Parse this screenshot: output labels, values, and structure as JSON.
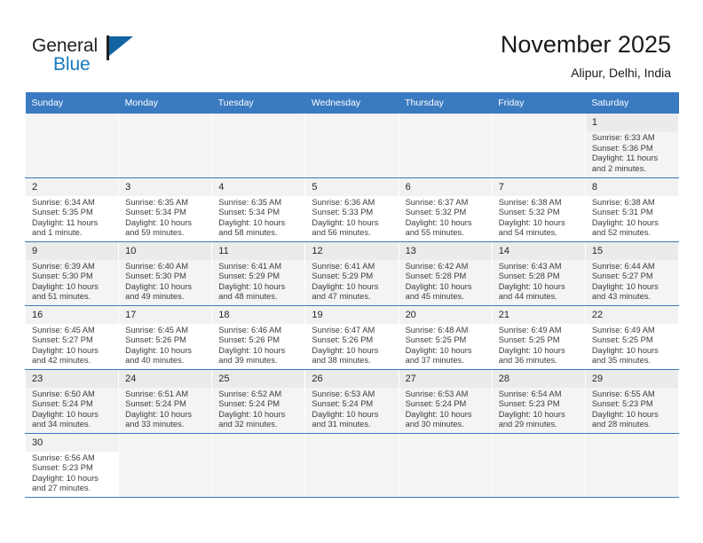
{
  "brand": {
    "name_top": "General",
    "name_bottom": "Blue",
    "flag_color": "#1264a3",
    "text_color": "#231f20",
    "blue_color": "#1878be"
  },
  "header": {
    "title": "November 2025",
    "subtitle": "Alipur, Delhi, India",
    "accent_color": "#3a7ac0"
  },
  "weekdays": [
    "Sunday",
    "Monday",
    "Tuesday",
    "Wednesday",
    "Thursday",
    "Friday",
    "Saturday"
  ],
  "labels": {
    "sunrise": "Sunrise:",
    "sunset": "Sunset:",
    "daylight": "Daylight:"
  },
  "weeks": [
    [
      {
        "day": "",
        "empty": true
      },
      {
        "day": "",
        "empty": true
      },
      {
        "day": "",
        "empty": true
      },
      {
        "day": "",
        "empty": true
      },
      {
        "day": "",
        "empty": true
      },
      {
        "day": "",
        "empty": true
      },
      {
        "day": "1",
        "sunrise": "Sunrise: 6:33 AM",
        "sunset": "Sunset: 5:36 PM",
        "daylight": "Daylight: 11 hours and 2 minutes."
      }
    ],
    [
      {
        "day": "2",
        "sunrise": "Sunrise: 6:34 AM",
        "sunset": "Sunset: 5:35 PM",
        "daylight": "Daylight: 11 hours and 1 minute."
      },
      {
        "day": "3",
        "sunrise": "Sunrise: 6:35 AM",
        "sunset": "Sunset: 5:34 PM",
        "daylight": "Daylight: 10 hours and 59 minutes."
      },
      {
        "day": "4",
        "sunrise": "Sunrise: 6:35 AM",
        "sunset": "Sunset: 5:34 PM",
        "daylight": "Daylight: 10 hours and 58 minutes."
      },
      {
        "day": "5",
        "sunrise": "Sunrise: 6:36 AM",
        "sunset": "Sunset: 5:33 PM",
        "daylight": "Daylight: 10 hours and 56 minutes."
      },
      {
        "day": "6",
        "sunrise": "Sunrise: 6:37 AM",
        "sunset": "Sunset: 5:32 PM",
        "daylight": "Daylight: 10 hours and 55 minutes."
      },
      {
        "day": "7",
        "sunrise": "Sunrise: 6:38 AM",
        "sunset": "Sunset: 5:32 PM",
        "daylight": "Daylight: 10 hours and 54 minutes."
      },
      {
        "day": "8",
        "sunrise": "Sunrise: 6:38 AM",
        "sunset": "Sunset: 5:31 PM",
        "daylight": "Daylight: 10 hours and 52 minutes."
      }
    ],
    [
      {
        "day": "9",
        "sunrise": "Sunrise: 6:39 AM",
        "sunset": "Sunset: 5:30 PM",
        "daylight": "Daylight: 10 hours and 51 minutes."
      },
      {
        "day": "10",
        "sunrise": "Sunrise: 6:40 AM",
        "sunset": "Sunset: 5:30 PM",
        "daylight": "Daylight: 10 hours and 49 minutes."
      },
      {
        "day": "11",
        "sunrise": "Sunrise: 6:41 AM",
        "sunset": "Sunset: 5:29 PM",
        "daylight": "Daylight: 10 hours and 48 minutes."
      },
      {
        "day": "12",
        "sunrise": "Sunrise: 6:41 AM",
        "sunset": "Sunset: 5:29 PM",
        "daylight": "Daylight: 10 hours and 47 minutes."
      },
      {
        "day": "13",
        "sunrise": "Sunrise: 6:42 AM",
        "sunset": "Sunset: 5:28 PM",
        "daylight": "Daylight: 10 hours and 45 minutes."
      },
      {
        "day": "14",
        "sunrise": "Sunrise: 6:43 AM",
        "sunset": "Sunset: 5:28 PM",
        "daylight": "Daylight: 10 hours and 44 minutes."
      },
      {
        "day": "15",
        "sunrise": "Sunrise: 6:44 AM",
        "sunset": "Sunset: 5:27 PM",
        "daylight": "Daylight: 10 hours and 43 minutes."
      }
    ],
    [
      {
        "day": "16",
        "sunrise": "Sunrise: 6:45 AM",
        "sunset": "Sunset: 5:27 PM",
        "daylight": "Daylight: 10 hours and 42 minutes."
      },
      {
        "day": "17",
        "sunrise": "Sunrise: 6:45 AM",
        "sunset": "Sunset: 5:26 PM",
        "daylight": "Daylight: 10 hours and 40 minutes."
      },
      {
        "day": "18",
        "sunrise": "Sunrise: 6:46 AM",
        "sunset": "Sunset: 5:26 PM",
        "daylight": "Daylight: 10 hours and 39 minutes."
      },
      {
        "day": "19",
        "sunrise": "Sunrise: 6:47 AM",
        "sunset": "Sunset: 5:26 PM",
        "daylight": "Daylight: 10 hours and 38 minutes."
      },
      {
        "day": "20",
        "sunrise": "Sunrise: 6:48 AM",
        "sunset": "Sunset: 5:25 PM",
        "daylight": "Daylight: 10 hours and 37 minutes."
      },
      {
        "day": "21",
        "sunrise": "Sunrise: 6:49 AM",
        "sunset": "Sunset: 5:25 PM",
        "daylight": "Daylight: 10 hours and 36 minutes."
      },
      {
        "day": "22",
        "sunrise": "Sunrise: 6:49 AM",
        "sunset": "Sunset: 5:25 PM",
        "daylight": "Daylight: 10 hours and 35 minutes."
      }
    ],
    [
      {
        "day": "23",
        "sunrise": "Sunrise: 6:50 AM",
        "sunset": "Sunset: 5:24 PM",
        "daylight": "Daylight: 10 hours and 34 minutes."
      },
      {
        "day": "24",
        "sunrise": "Sunrise: 6:51 AM",
        "sunset": "Sunset: 5:24 PM",
        "daylight": "Daylight: 10 hours and 33 minutes."
      },
      {
        "day": "25",
        "sunrise": "Sunrise: 6:52 AM",
        "sunset": "Sunset: 5:24 PM",
        "daylight": "Daylight: 10 hours and 32 minutes."
      },
      {
        "day": "26",
        "sunrise": "Sunrise: 6:53 AM",
        "sunset": "Sunset: 5:24 PM",
        "daylight": "Daylight: 10 hours and 31 minutes."
      },
      {
        "day": "27",
        "sunrise": "Sunrise: 6:53 AM",
        "sunset": "Sunset: 5:24 PM",
        "daylight": "Daylight: 10 hours and 30 minutes."
      },
      {
        "day": "28",
        "sunrise": "Sunrise: 6:54 AM",
        "sunset": "Sunset: 5:23 PM",
        "daylight": "Daylight: 10 hours and 29 minutes."
      },
      {
        "day": "29",
        "sunrise": "Sunrise: 6:55 AM",
        "sunset": "Sunset: 5:23 PM",
        "daylight": "Daylight: 10 hours and 28 minutes."
      }
    ],
    [
      {
        "day": "30",
        "sunrise": "Sunrise: 6:56 AM",
        "sunset": "Sunset: 5:23 PM",
        "daylight": "Daylight: 10 hours and 27 minutes."
      },
      {
        "day": "",
        "empty": true
      },
      {
        "day": "",
        "empty": true
      },
      {
        "day": "",
        "empty": true
      },
      {
        "day": "",
        "empty": true
      },
      {
        "day": "",
        "empty": true
      },
      {
        "day": "",
        "empty": true
      }
    ]
  ]
}
